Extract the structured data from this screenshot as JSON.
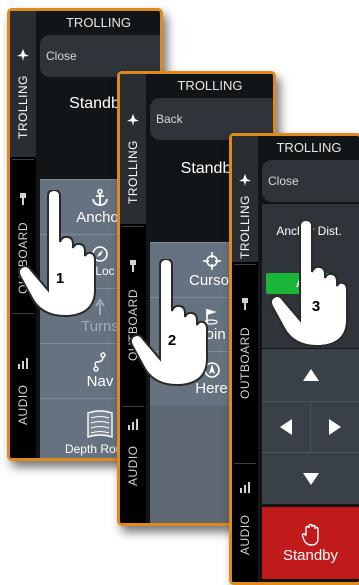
{
  "colors": {
    "panel_border": "#e08a1e",
    "panel_bg": "#121518",
    "button_grey": "#667280",
    "auto_green": "#19b63a",
    "standby_red": "#c11a1a"
  },
  "panel1": {
    "sidebar": [
      "TROLLING",
      "OUTBOARD",
      "AUDIO"
    ],
    "title": "TROLLING",
    "header_button": "Close",
    "status": "Standby",
    "buttons": {
      "anchor": "Anchor",
      "heading_lock": "g Loc",
      "turns": "Turns",
      "nav": "Nav",
      "depth_routing": "Depth Routin"
    },
    "step": "1"
  },
  "panel2": {
    "sidebar": [
      "TROLLING",
      "OUTBOARD",
      "AUDIO"
    ],
    "title": "TROLLING",
    "header_button": "Back",
    "status": "Standby",
    "buttons": {
      "cursor": "Cursor",
      "waypoint": "poin",
      "here": "Here"
    },
    "step": "2"
  },
  "panel3": {
    "sidebar": [
      "TROLLING",
      "OUTBOARD",
      "AUDIO"
    ],
    "title": "TROLLING",
    "header_button": "Close",
    "anchor_distance": "Anchor Dist.",
    "auto_button": "A",
    "standby_button": "Standby",
    "step": "3"
  },
  "icons": [
    "trolling-motor-icon",
    "outboard-icon",
    "audio-bars-icon",
    "anchor-icon",
    "compass-icon",
    "turns-icon",
    "nav-route-icon",
    "depth-routing-icon",
    "crosshair-icon",
    "waypoint-icon",
    "here-icon",
    "arrow-up-icon",
    "arrow-left-icon",
    "arrow-right-icon",
    "arrow-down-icon",
    "hand-stop-icon",
    "pointing-hand-icon"
  ]
}
